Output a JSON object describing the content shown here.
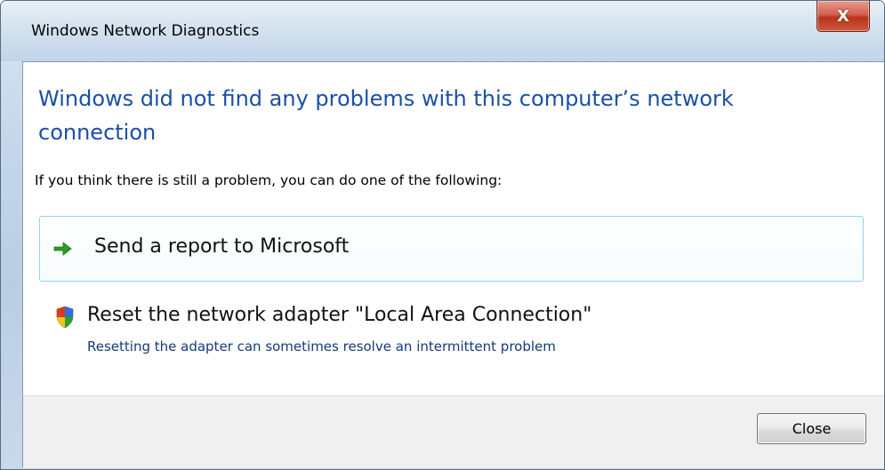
{
  "window": {
    "title": "Windows Network Diagnostics",
    "close_glyph": "X"
  },
  "main": {
    "headline": "Windows did not find any problems with this computer’s network connection",
    "subtext": "If you think there is still a problem, you can do one of the following:",
    "options": [
      {
        "label": "Send a report to Microsoft",
        "icon": "green-arrow-icon"
      },
      {
        "label": "Reset the network adapter \"Local Area Connection\"",
        "description": "Resetting the adapter can sometimes resolve an intermittent problem",
        "icon": "uac-shield-icon"
      }
    ]
  },
  "footer": {
    "close_label": "Close"
  },
  "colors": {
    "headline": "#1b4fa8",
    "option_border": "#8fd6ea",
    "arrow": "#2a9d1f",
    "description": "#123b7d"
  }
}
